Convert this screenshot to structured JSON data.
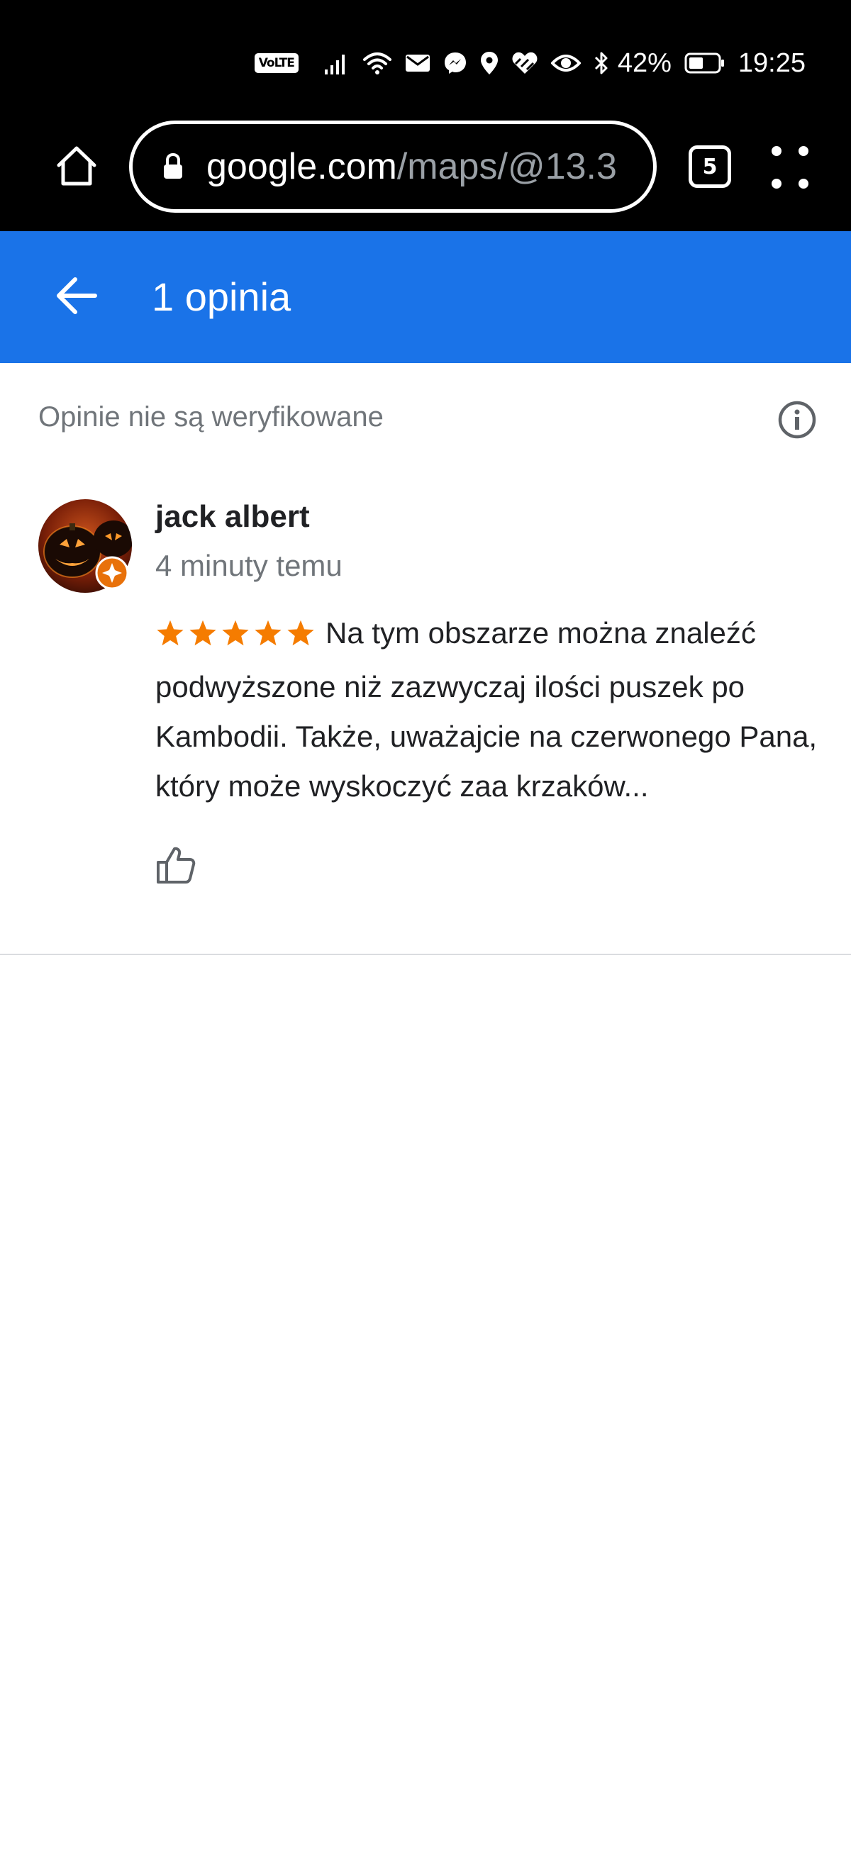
{
  "status_bar": {
    "volte": "VoLTE",
    "battery_percent": "42%",
    "time": "19:25",
    "icons": [
      "signal-icon",
      "wifi-icon",
      "mail-icon",
      "messenger-icon",
      "location-icon",
      "huawei-health-icon",
      "eye-comfort-icon",
      "bluetooth-icon",
      "battery-icon"
    ]
  },
  "browser": {
    "url_host": "google.com",
    "url_path": "/maps/@13.3",
    "tab_count": "5",
    "icons": [
      "home-icon",
      "lock-icon",
      "more-menu-icon"
    ]
  },
  "header": {
    "title": "1 opinia",
    "background": "#1a73e8"
  },
  "notice": {
    "text": "Opinie nie są weryfikowane"
  },
  "review": {
    "author": "jack albert",
    "time": "4 minuty temu",
    "rating": 5,
    "star_color": "#f57c00",
    "text": "Na tym obszarze można znaleźć podwyższone niż zazwyczaj ilości puszek po Kambodii. Także, uważajcie na czerwonego Pana, który może wyskoczyć zaa krzaków..."
  }
}
